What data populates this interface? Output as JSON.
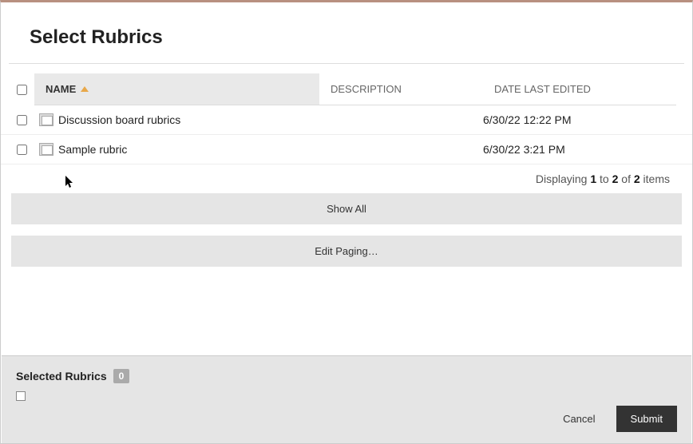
{
  "page_title": "Select Rubrics",
  "columns": {
    "name": "NAME",
    "description": "DESCRIPTION",
    "date_last_edited": "DATE LAST EDITED"
  },
  "rows": [
    {
      "name": "Discussion board rubrics",
      "description": "",
      "date": "6/30/22 12:22 PM"
    },
    {
      "name": "Sample rubric",
      "description": "",
      "date": "6/30/22 3:21 PM"
    }
  ],
  "paging": {
    "prefix": "Displaying ",
    "start": "1",
    "to_word": " to ",
    "end": "2",
    "of_word": " of ",
    "total": "2",
    "suffix": " items"
  },
  "buttons": {
    "show_all": "Show All",
    "edit_paging": "Edit Paging…",
    "cancel": "Cancel",
    "submit": "Submit"
  },
  "selected": {
    "label": "Selected Rubrics",
    "count": "0"
  }
}
